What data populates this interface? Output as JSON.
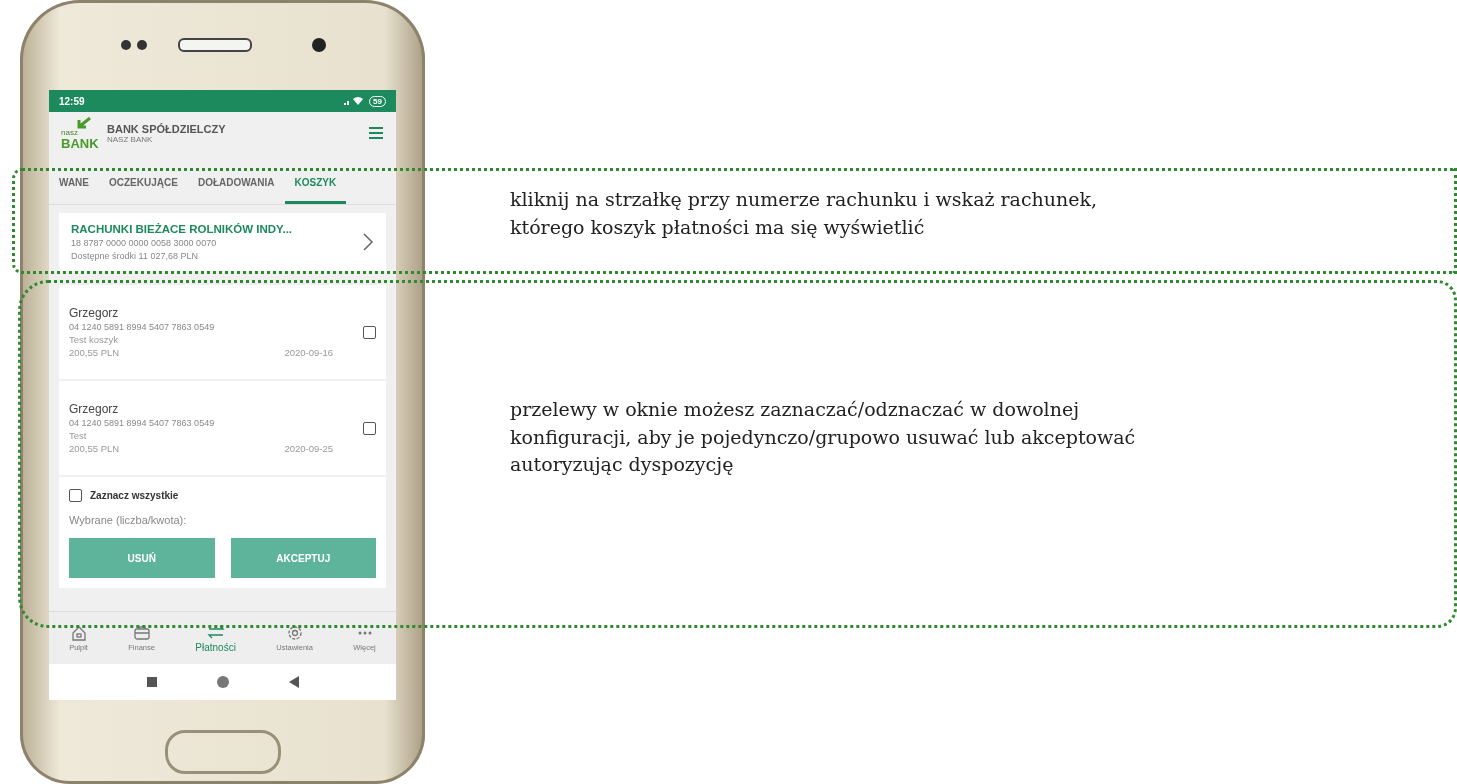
{
  "phone": {
    "status_bar": {
      "time": "12:59",
      "battery": "59"
    },
    "header": {
      "logo_small": "nasz",
      "logo": "BANK",
      "title": "BANK SPÓŁDZIELCZY",
      "subtitle": "NASZ BANK"
    },
    "tabs": [
      {
        "label": "WANE",
        "selected": false
      },
      {
        "label": "OCZEKUJĄCE",
        "selected": false
      },
      {
        "label": "DOŁADOWANIA",
        "selected": false
      },
      {
        "label": "KOSZYK",
        "selected": true
      }
    ],
    "account": {
      "name": "RACHUNKI BIEŻACE ROLNIKÓW INDY...",
      "number": "18 8787 0000 0000 0058 3000 0070",
      "balance": "Dostępne środki 11 027,68 PLN"
    },
    "transfers": [
      {
        "recipient": "Grzegorz",
        "account": "04 1240 5891 8994 5407 7863 0549",
        "title": "Test koszyk",
        "amount": "200,55 PLN",
        "date": "2020-09-16",
        "checked": false
      },
      {
        "recipient": "Grzegorz",
        "account": "04 1240 5891 8994 5407 7863 0549",
        "title": "Test",
        "amount": "200,55 PLN",
        "date": "2020-09-25",
        "checked": false
      }
    ],
    "select_all": {
      "label": "Zaznacz wszystkie",
      "checked": false
    },
    "selected_summary": "Wybrane (liczba/kwota):",
    "buttons": [
      "USUŃ",
      "AKCEPTUJ"
    ],
    "bottom_nav": [
      {
        "label": "Pulpit",
        "kind": "home",
        "selected": false
      },
      {
        "label": "Finanse",
        "kind": "wallet",
        "selected": false
      },
      {
        "label": "Płatności",
        "kind": "transfer",
        "selected": true
      },
      {
        "label": "Ustawienia",
        "kind": "settings",
        "selected": false
      },
      {
        "label": "Więcej",
        "kind": "more",
        "selected": false
      }
    ]
  },
  "callouts": [
    "kliknij na strzałkę przy numerze rachunku i wskaż rachunek, którego koszyk płatności ma się wyświetlić",
    "przelewy w oknie możesz zaznaczać/odznaczać w dowolnej konfiguracji, aby je pojedynczo/grupowo usuwać lub akceptować autoryzując dyspozycję"
  ]
}
